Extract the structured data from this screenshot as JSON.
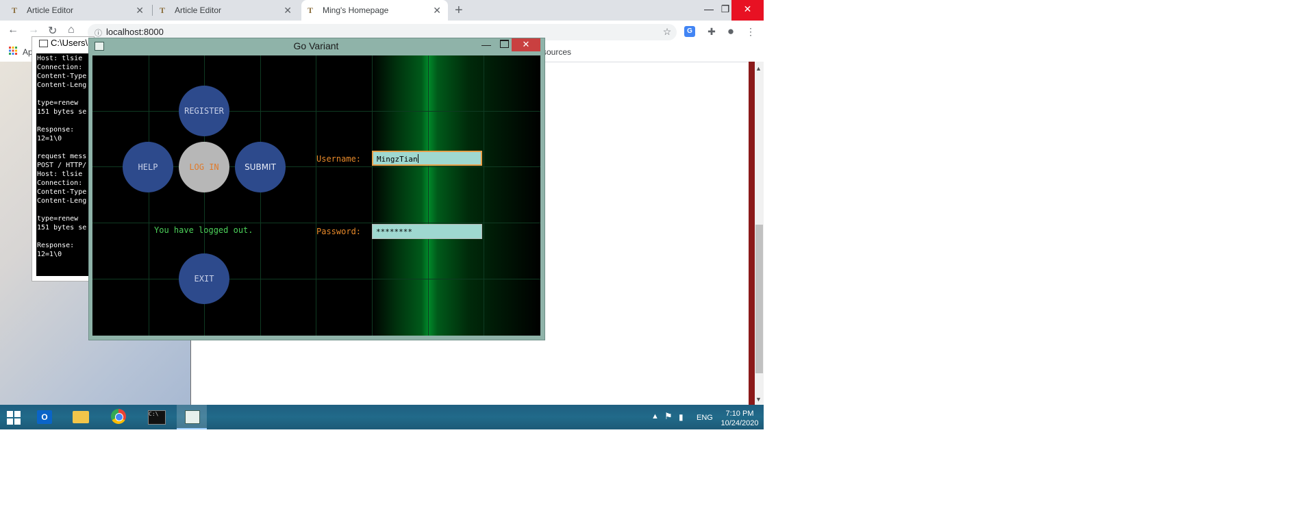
{
  "browser": {
    "tabs": [
      {
        "label": "Article Editor",
        "active": false
      },
      {
        "label": "Article Editor",
        "active": false
      },
      {
        "label": "Ming's Homepage",
        "active": true
      }
    ],
    "url": "localhost:8000",
    "bookmarks": {
      "apps_label": "Ap",
      "partial_label": "sources"
    }
  },
  "console": {
    "title": "C:\\Users\\",
    "lines": "Host: tlsie\nConnection:\nContent-Type\nContent-Leng\n\ntype=renew\n151 bytes se\n\nResponse:\n12=1\\0\n\nrequest mess\nPOST / HTTP/\nHost: tlsie\nConnection:\nContent-Type\nContent-Leng\n\ntype=renew\n151 bytes se\n\nResponse:\n12=1\\0"
  },
  "app": {
    "title": "Go Variant",
    "buttons": {
      "register": "REGISTER",
      "help": "HELP",
      "login": "LOG IN",
      "submit": "SUBMIT",
      "exit": "EXIT"
    },
    "status_message": "You have logged out.",
    "form": {
      "username_label": "Username:",
      "username_value": "MingzTian",
      "password_label": "Password:",
      "password_value": "********"
    }
  },
  "taskbar": {
    "language": "ENG",
    "time": "7:10 PM",
    "date": "10/24/2020"
  },
  "colors": {
    "board_accent": "#008a2a",
    "button_blue": "#2d4a8c",
    "label_orange": "#e88a2a",
    "status_green": "#4cd15a",
    "field_bg": "#9fd8d0"
  }
}
